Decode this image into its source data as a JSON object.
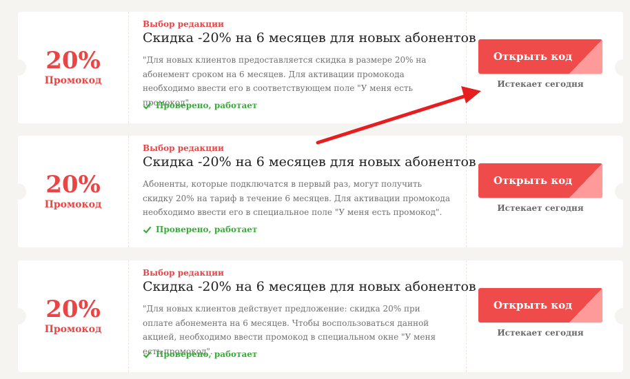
{
  "coupons": [
    {
      "discount": "20%",
      "type_label": "Промокод",
      "tag": "Выбор редакции",
      "title": "Скидка -20% на 6 месяцев для новых абонентов",
      "description": "\"Для новых клиентов предоставляется скидка в размере 20% на абонемент сроком на 6 месяцев. Для активации промокода необходимо ввести его в соответствующем поле \"У меня есть промокод\".",
      "verified": "Проверено, работает",
      "button": "Открыть код",
      "expires": "Истекает сегодня"
    },
    {
      "discount": "20%",
      "type_label": "Промокод",
      "tag": "Выбор редакции",
      "title": "Скидка -20% на 6 месяцев для новых абонентов",
      "description": "Абоненты, которые подключатся в первый раз, могут получить скидку 20% на тариф в течение 6 месяцев. Для активации промокода необходимо ввести его в специальное поле \"У меня есть промокод\".",
      "verified": "Проверено, работает",
      "button": "Открыть код",
      "expires": "Истекает сегодня"
    },
    {
      "discount": "20%",
      "type_label": "Промокод",
      "tag": "Выбор редакции",
      "title": "Скидка -20% на 6 месяцев для новых абонентов",
      "description": "\"Для новых клиентов действует предложение: скидка 20% при оплате абонемента на 6 месяцев. Чтобы воспользоваться данной акцией, необходимо ввести промокод в специальном окне \"У меня есть промокод\".",
      "verified": "Проверено, работает",
      "button": "Открыть код",
      "expires": "Истекает сегодня"
    }
  ],
  "colors": {
    "accent_red": "#ea4545",
    "button_red": "#f04b4b",
    "verified_green": "#3bac3b",
    "annotation_arrow": "#e51f1f"
  },
  "icons": [
    "check-icon",
    "annotation-arrow"
  ]
}
